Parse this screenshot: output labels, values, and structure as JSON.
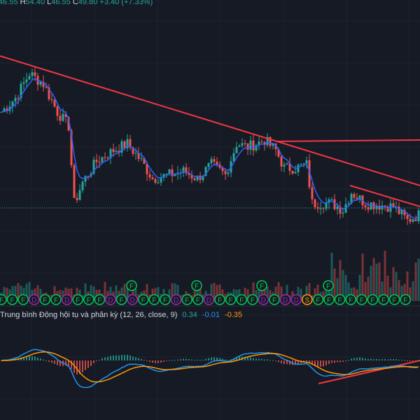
{
  "ohlc": {
    "o": "46.55",
    "h_label": "H",
    "h": "54.40",
    "l_label": "L",
    "l": "46.55",
    "c_label": "C",
    "c": "49.80",
    "change": "+3.40 (+7.33%)"
  },
  "macd": {
    "title": "Trung bình Động hội tụ và phân kỳ (12, 26, close, 9)",
    "macd": "0.34",
    "signal": "-0.01",
    "hist": "-0.35"
  },
  "colors": {
    "bg": "#161a25",
    "up": "#26a69a",
    "down": "#ef5350",
    "ma": "#2962ff",
    "trend": "#f23645",
    "macd_line": "#2196f3",
    "signal_line": "#ff9800",
    "marker_f": "#00c853",
    "marker_d": "#9c27b0",
    "marker_s": "#ff9800"
  },
  "chart_data": {
    "type": "candlestick",
    "reference_price": 46.55,
    "close_keypoints": [
      [
        0,
        57.97
      ],
      [
        5,
        59.63
      ],
      [
        10,
        62.55
      ],
      [
        15,
        61.3
      ],
      [
        20,
        57.97
      ],
      [
        24,
        56.3
      ],
      [
        26,
        47.1
      ],
      [
        29,
        49.6
      ],
      [
        34,
        52.1
      ],
      [
        40,
        53.4
      ],
      [
        45,
        54.2
      ],
      [
        50,
        52.1
      ],
      [
        54,
        50.05
      ],
      [
        60,
        50.5
      ],
      [
        65,
        50.9
      ],
      [
        70,
        50.05
      ],
      [
        75,
        51.7
      ],
      [
        80,
        50.5
      ],
      [
        84,
        54.2
      ],
      [
        88,
        53.8
      ],
      [
        94,
        54.6
      ],
      [
        98,
        53.4
      ],
      [
        101,
        51.3
      ],
      [
        105,
        51.3
      ],
      [
        109,
        51.7
      ],
      [
        111,
        47.1
      ],
      [
        118,
        47.1
      ],
      [
        122,
        46.3
      ],
      [
        125,
        48.4
      ],
      [
        130,
        47.1
      ],
      [
        140,
        46.7
      ],
      [
        145,
        45.05
      ],
      [
        150,
        45.9
      ]
    ],
    "markers_lower": [
      "F",
      "F",
      "F",
      "D",
      "F",
      "F",
      "D",
      "F",
      "F",
      "F",
      "D",
      "F",
      "D",
      "F",
      "F",
      "F",
      "D",
      "F",
      "F",
      "D",
      "F",
      "F",
      "F",
      "F",
      "D",
      "F",
      "D",
      "D",
      "S",
      "F",
      "F",
      "F",
      "F",
      "F",
      "F",
      "F",
      "F",
      "F"
    ],
    "markers_upper": [
      "F",
      "F",
      "F",
      "F"
    ],
    "series": [
      {
        "name": "MA"
      },
      {
        "name": "MACD"
      },
      {
        "name": "Signal"
      },
      {
        "name": "Histogram"
      }
    ]
  }
}
